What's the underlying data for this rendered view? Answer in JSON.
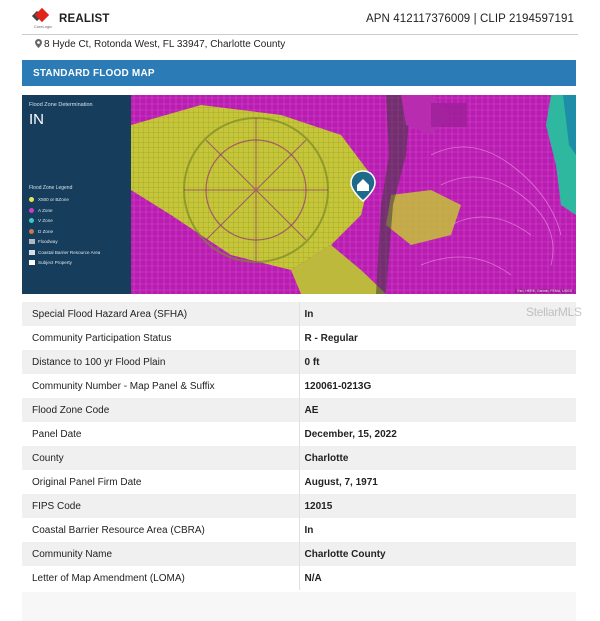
{
  "header": {
    "logo_text": "CoreLogic",
    "brand": "REALIST",
    "apn_clip": "APN 412117376009 | CLIP 2194597191"
  },
  "address": "8 Hyde Ct, Rotonda West, FL 33947, Charlotte County",
  "banner": "STANDARD FLOOD MAP",
  "map": {
    "determination_label": "Flood Zone Determination",
    "determination_value": "IN",
    "legend_title": "Flood Zone Legend",
    "legend": [
      {
        "label": "X500 or BZone",
        "color": "#e6e65a",
        "shape": "dot"
      },
      {
        "label": "A Zone",
        "color": "#c83cc8",
        "shape": "dot"
      },
      {
        "label": "V Zone",
        "color": "#3cc8c8",
        "shape": "dot"
      },
      {
        "label": "D Zone",
        "color": "#c87850",
        "shape": "dot"
      },
      {
        "label": "Floodway",
        "color": "#b0b8c0",
        "shape": "square"
      },
      {
        "label": "Coastal Barrier Resource Area",
        "color": "#dddddd",
        "shape": "square"
      },
      {
        "label": "Subject Property",
        "color": "#ffffff",
        "shape": "square"
      }
    ],
    "attribution": "Esri, HERE, Garmin, FEMA, USGS"
  },
  "rows": [
    {
      "label": "Special Flood Hazard Area (SFHA)",
      "value": "In"
    },
    {
      "label": "Community Participation Status",
      "value": "R - Regular"
    },
    {
      "label": "Distance to 100 yr Flood Plain",
      "value": "0 ft"
    },
    {
      "label": "Community Number - Map Panel & Suffix",
      "value": "120061-0213G"
    },
    {
      "label": "Flood Zone Code",
      "value": "AE"
    },
    {
      "label": "Panel Date",
      "value": "December, 15, 2022"
    },
    {
      "label": "County",
      "value": "Charlotte"
    },
    {
      "label": "Original Panel Firm Date",
      "value": "August, 7, 1971"
    },
    {
      "label": "FIPS Code",
      "value": "12015"
    },
    {
      "label": "Coastal Barrier Resource Area (CBRA)",
      "value": "In"
    },
    {
      "label": "Community Name",
      "value": "Charlotte County"
    },
    {
      "label": "Letter of Map Amendment (LOMA)",
      "value": "N/A"
    }
  ],
  "watermark": "StellarMLS"
}
